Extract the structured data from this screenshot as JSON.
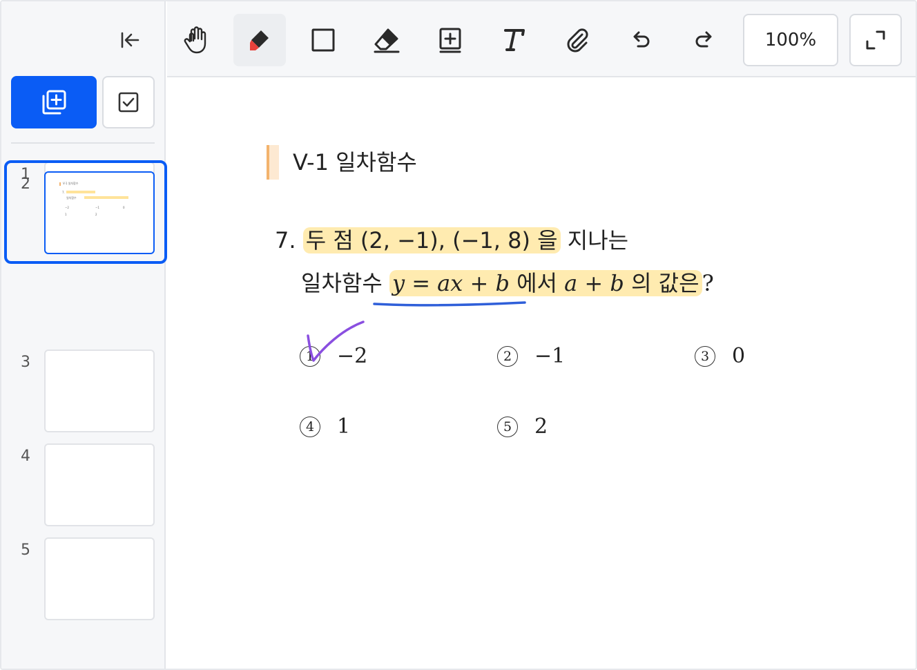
{
  "sidebar": {
    "pages": [
      {
        "number": "1"
      },
      {
        "number": "2"
      },
      {
        "number": "3"
      },
      {
        "number": "4"
      },
      {
        "number": "5"
      }
    ],
    "selected_page": "2"
  },
  "toolbar": {
    "tools": [
      "hand-icon",
      "highlighter-icon",
      "rectangle-icon",
      "eraser-icon",
      "add-box-icon",
      "text-icon",
      "attachment-icon",
      "undo-icon",
      "redo-icon"
    ],
    "active_tool": "highlighter-icon",
    "zoom": "100%"
  },
  "document": {
    "section_title": "V-1 일차함수",
    "question_number": "7.",
    "line1_hl": "두 점 (2, −1), (−1, 8) 을",
    "line1_rest": " 지나는",
    "line2_kr": "일차함수 ",
    "line2_eq": "y = ax + b",
    "line2_mid": " 에서 ",
    "line2_expr": "a + b",
    "line2_tail": " 의 값은",
    "line2_q": "?",
    "choices": [
      {
        "mark": "1",
        "value": "−2"
      },
      {
        "mark": "2",
        "value": "−1"
      },
      {
        "mark": "3",
        "value": "0"
      },
      {
        "mark": "4",
        "value": "1"
      },
      {
        "mark": "5",
        "value": "2"
      }
    ]
  },
  "colors": {
    "accent": "#0a5cf5",
    "highlight": "#ffd250",
    "underline_pen": "#2f5fd9",
    "check_pen": "#8a4fe0",
    "section_bar": "#f3b36d"
  }
}
